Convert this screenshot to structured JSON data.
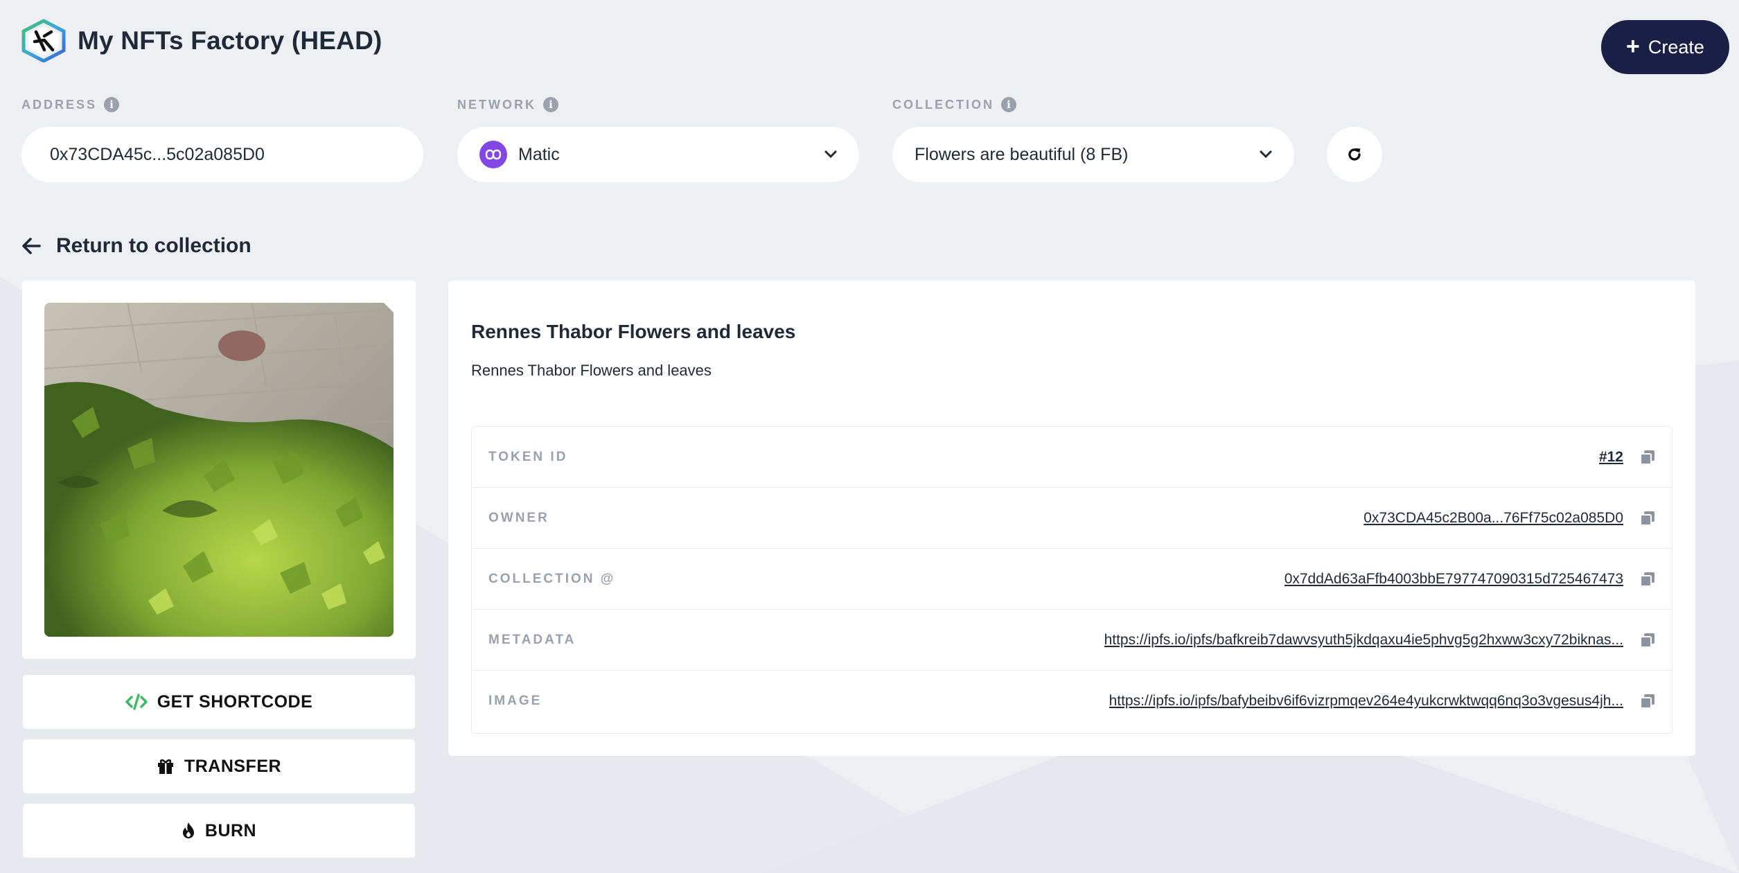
{
  "app": {
    "title": "My NFTs Factory (HEAD)",
    "create_label": "Create"
  },
  "filters": {
    "address": {
      "label": "ADDRESS",
      "value": "0x73CDA45c...5c02a085D0"
    },
    "network": {
      "label": "NETWORK",
      "value": "Matic"
    },
    "collection": {
      "label": "COLLECTION",
      "value": "Flowers are beautiful (8 FB)"
    }
  },
  "nav": {
    "return_label": "Return to collection"
  },
  "actions": {
    "shortcode_label": "GET SHORTCODE",
    "transfer_label": "TRANSFER",
    "burn_label": "BURN"
  },
  "nft": {
    "name": "Rennes Thabor Flowers and leaves",
    "description": "Rennes Thabor Flowers and leaves",
    "properties": [
      {
        "key": "TOKEN ID",
        "value": "#12"
      },
      {
        "key": "OWNER",
        "value": "0x73CDA45c2B00a...76Ff75c02a085D0"
      },
      {
        "key": "COLLECTION @",
        "value": "0x7ddAd63aFfb4003bbE797747090315d725467473"
      },
      {
        "key": "METADATA",
        "value": "https://ipfs.io/ipfs/bafkreib7dawvsyuth5jkdqaxu4ie5phvg5g2hxww3cxy72biknas..."
      },
      {
        "key": "IMAGE",
        "value": "https://ipfs.io/ipfs/bafybeibv6if6vizrpmqev264e4yukcrwktwqq6nq3o3vgesus4jh..."
      }
    ]
  },
  "icons": {
    "logo": "kredeum-hexagon-logo",
    "info": "info-circle-icon",
    "network": "polygon-icon",
    "chevron": "chevron-down-icon",
    "refresh": "refresh-icon",
    "back": "arrow-left-icon",
    "shortcode": "code-icon",
    "transfer": "gift-icon",
    "burn": "fire-icon",
    "copy": "copy-icon"
  },
  "colors": {
    "primary_button": "#1c1f45",
    "polygon_purple": "#8247e5",
    "code_green": "#3cba62",
    "background": "#edeff3"
  }
}
